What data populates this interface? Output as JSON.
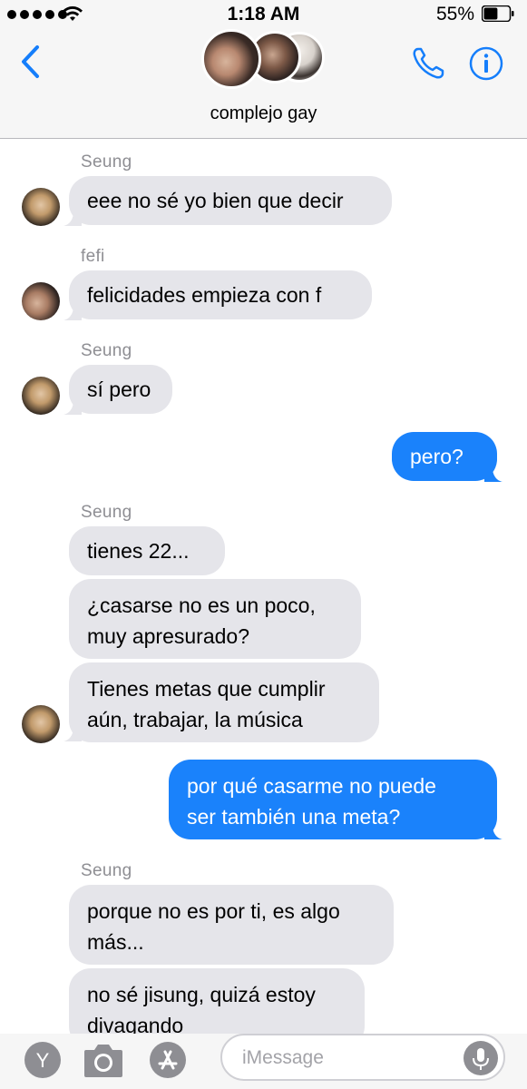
{
  "status_bar": {
    "time": "1:18 AM",
    "battery_percent": "55%",
    "battery_level": 0.55
  },
  "header": {
    "group_name": "complejo gay",
    "back_icon": "chevron-left-icon",
    "call_icon": "phone-icon",
    "info_icon": "info-icon"
  },
  "messages": [
    {
      "sender": "Seung",
      "text": "eee no sé yo bien que decir"
    },
    {
      "sender": "fefi",
      "text": "felicidades empieza con f"
    },
    {
      "sender": "Seung",
      "text": "sí pero"
    },
    {
      "sender": "",
      "text": "pero?"
    },
    {
      "sender": "Seung",
      "text": "tienes 22..."
    },
    {
      "sender": "",
      "line1": "¿casarse no es un poco,",
      "line2": "muy apresurado?"
    },
    {
      "sender": "",
      "line1": "Tienes metas que cumplir",
      "line2": "aún, trabajar, la música"
    },
    {
      "sender": "",
      "line1": "por qué casarme no puede",
      "line2": "ser también una meta?"
    },
    {
      "sender": "Seung",
      "line1": "porque no es por ti, es algo",
      "line2": "más..."
    },
    {
      "sender": "",
      "line1": "no sé jisung, quizá estoy",
      "line2": "divagando"
    }
  ],
  "input_bar": {
    "placeholder": "iMessage",
    "apps_icon": "apps-icon",
    "camera_icon": "camera-icon",
    "appstore_icon": "appstore-icon",
    "mic_icon": "mic-icon",
    "apps_letter": "Y"
  },
  "colors": {
    "outgoing": "#1a82fb",
    "incoming": "#e5e5ea",
    "accent": "#157efb"
  }
}
